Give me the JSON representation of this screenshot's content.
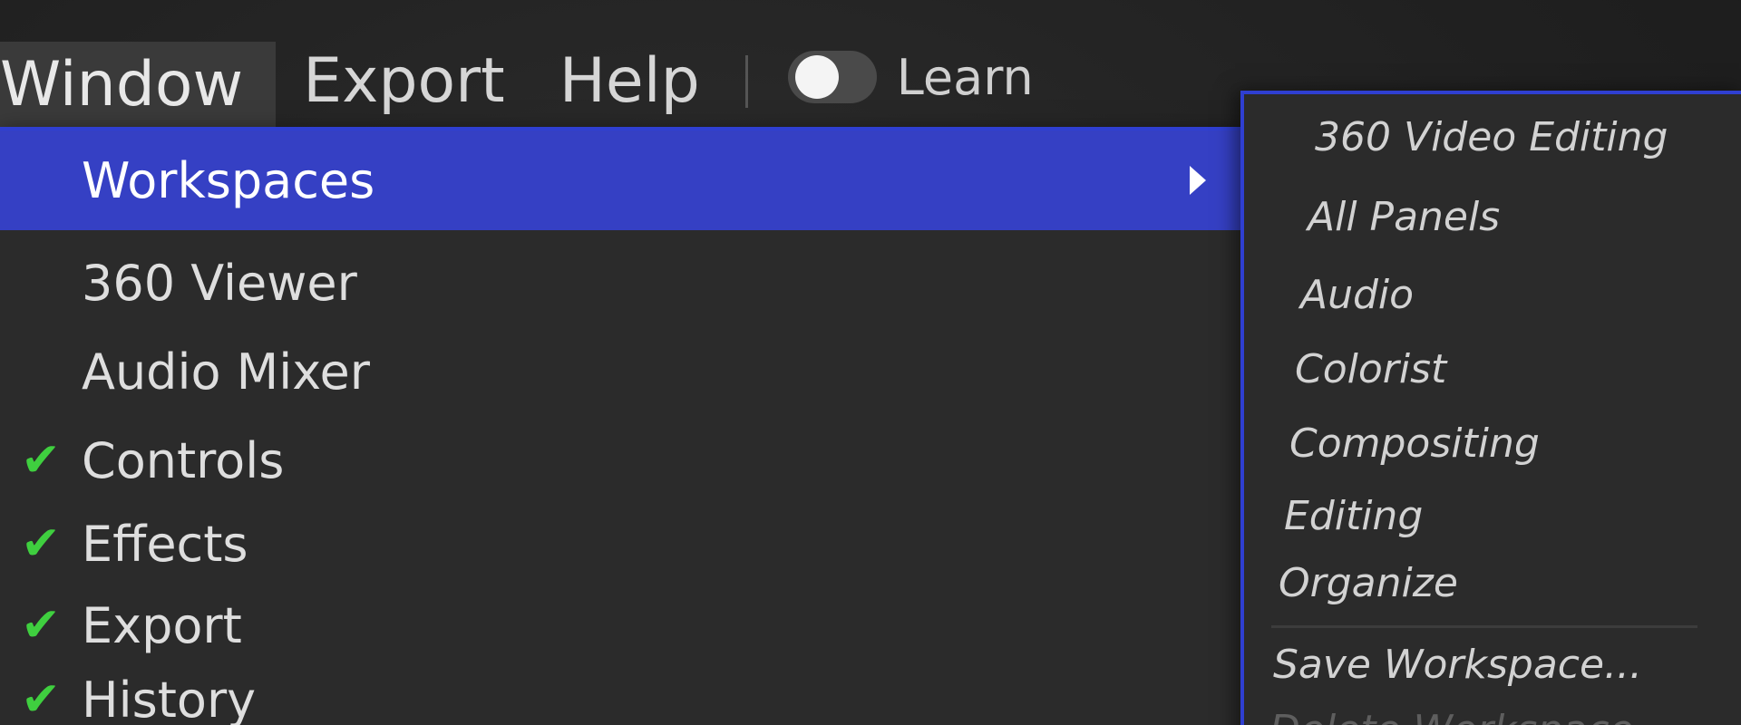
{
  "menubar": {
    "items": [
      {
        "label": "Window",
        "active": true
      },
      {
        "label": "Export",
        "active": false
      },
      {
        "label": "Help",
        "active": false
      }
    ],
    "learn_toggle": {
      "label": "Learn",
      "on": false
    }
  },
  "window_menu": {
    "items": [
      {
        "label": "Workspaces",
        "checked": false,
        "has_submenu": true,
        "highlighted": true
      },
      {
        "label": "360 Viewer",
        "checked": false
      },
      {
        "label": "Audio Mixer",
        "checked": false
      },
      {
        "label": "Controls",
        "checked": true
      },
      {
        "label": "Effects",
        "checked": true
      },
      {
        "label": "Export",
        "checked": true
      },
      {
        "label": "History",
        "checked": true
      }
    ]
  },
  "workspaces_submenu": {
    "items": [
      {
        "label": "360 Video Editing"
      },
      {
        "label": "All Panels"
      },
      {
        "label": "Audio"
      },
      {
        "label": "Colorist"
      },
      {
        "label": "Compositing"
      },
      {
        "label": "Editing"
      },
      {
        "label": "Organize"
      }
    ],
    "actions": [
      {
        "label": "Save Workspace..."
      },
      {
        "label": "Delete Workspace..."
      }
    ]
  },
  "colors": {
    "highlight": "#3540c4",
    "accent_border": "#2f3fd1",
    "check": "#3fcf3f",
    "menu_bg": "#2b2b2b"
  },
  "icons": {
    "check": "checkmark-icon",
    "submenu_arrow": "triangle-right-icon"
  }
}
